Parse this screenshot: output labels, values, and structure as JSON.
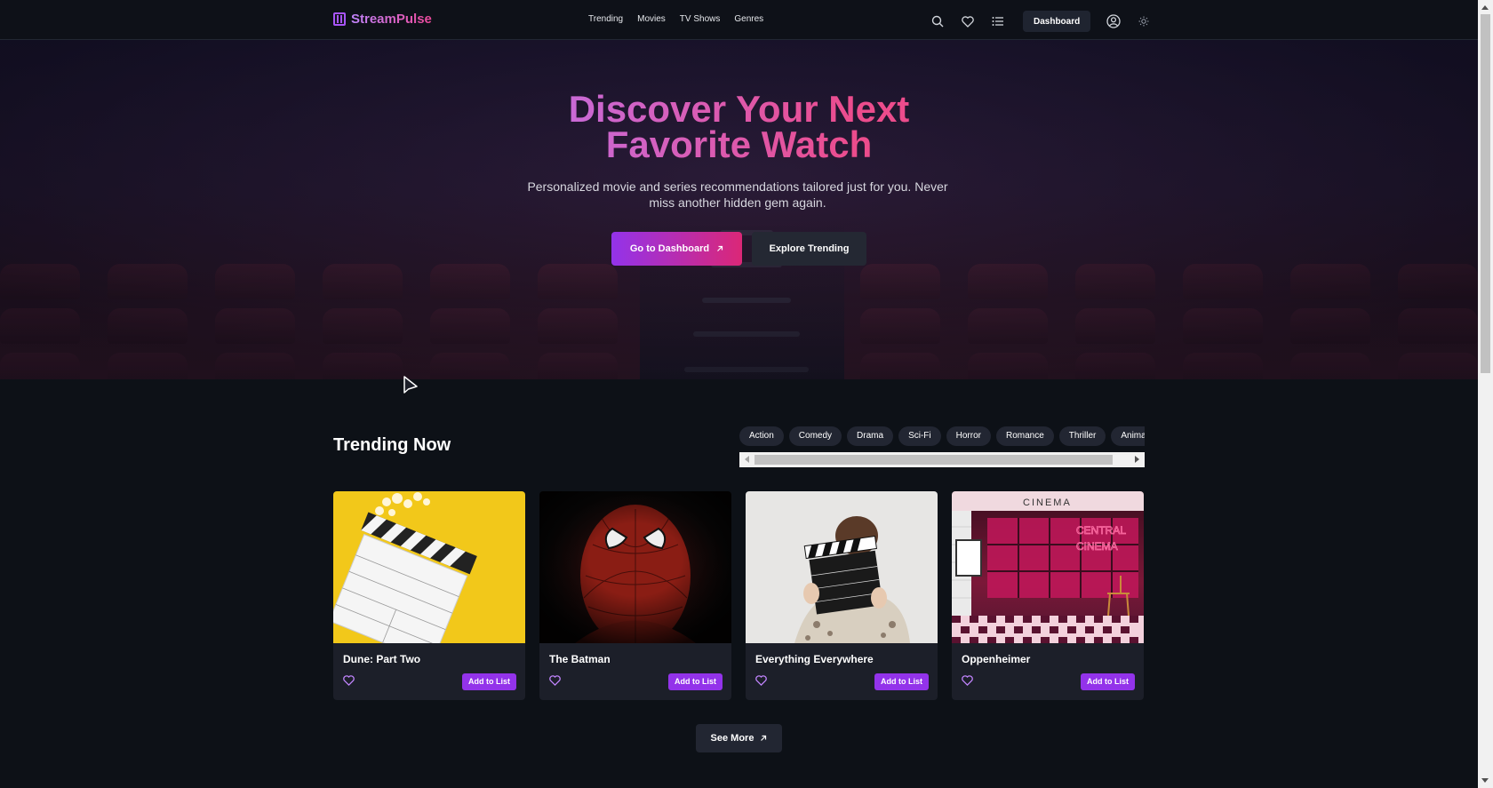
{
  "header": {
    "brand": "StreamPulse",
    "nav": [
      "Trending",
      "Movies",
      "TV Shows",
      "Genres"
    ],
    "dashboard_label": "Dashboard"
  },
  "hero": {
    "title_line1": "Discover Your Next",
    "title_line2": "Favorite Watch",
    "subtitle": "Personalized movie and series recommendations tailored just for you. Never miss another hidden gem again.",
    "primary_cta": "Go to Dashboard",
    "secondary_cta": "Explore Trending"
  },
  "trending": {
    "title": "Trending Now",
    "genres": [
      "Action",
      "Comedy",
      "Drama",
      "Sci-Fi",
      "Horror",
      "Romance",
      "Thriller",
      "Animatio"
    ],
    "cards": [
      {
        "title": "Dune: Part Two",
        "add_label": "Add to List"
      },
      {
        "title": "The Batman",
        "add_label": "Add to List"
      },
      {
        "title": "Everything Everywhere",
        "add_label": "Add to List"
      },
      {
        "title": "Oppenheimer",
        "add_label": "Add to List"
      }
    ],
    "see_more": "See More"
  },
  "colors": {
    "accent": "#9333ea",
    "accent_pink": "#db2777",
    "background": "#0d1117"
  }
}
